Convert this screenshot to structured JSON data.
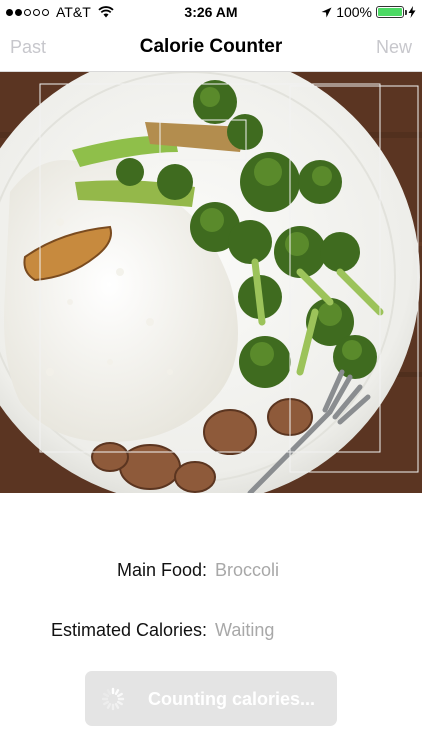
{
  "status_bar": {
    "carrier": "AT&T",
    "time": "3:26 AM",
    "battery": "100%"
  },
  "nav": {
    "left_label": "Past",
    "title": "Calorie Counter",
    "right_label": "New"
  },
  "info": {
    "main_food_label": "Main Food:",
    "main_food_value": "Broccoli",
    "calories_label": "Estimated Calories:",
    "calories_value": "Waiting"
  },
  "button": {
    "label": "Counting calories..."
  },
  "colors": {
    "nav_disabled": "#c7c7cc",
    "value_text": "#a8a8a8",
    "button_bg": "#e4e4e4",
    "battery_fill": "#4cd964"
  }
}
